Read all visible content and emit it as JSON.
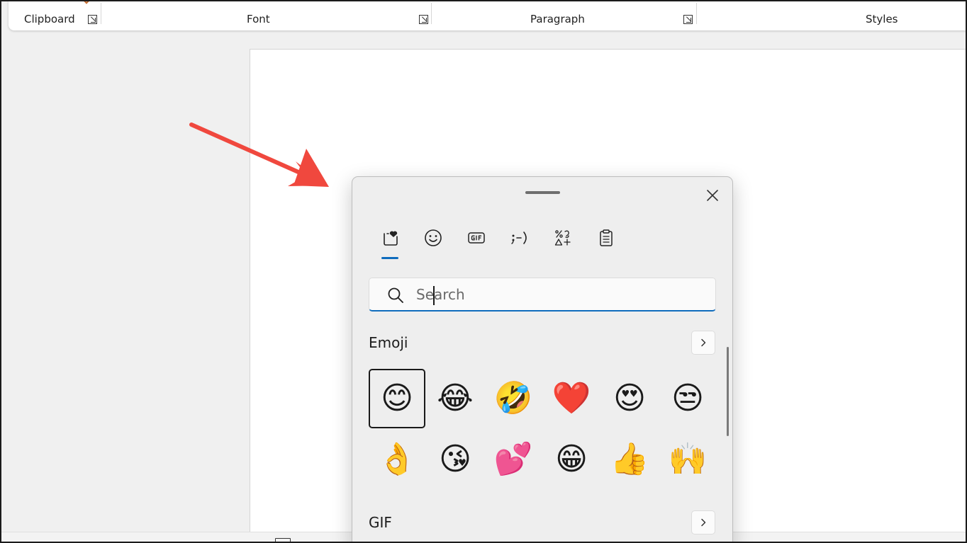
{
  "ribbon": {
    "groups": [
      {
        "label": "Clipboard"
      },
      {
        "label": "Font"
      },
      {
        "label": "Paragraph"
      },
      {
        "label": "Styles"
      }
    ]
  },
  "emoji_panel": {
    "tabs": [
      {
        "icon": "favorites-heart-icon"
      },
      {
        "icon": "smiley-icon"
      },
      {
        "icon": "gif-icon"
      },
      {
        "icon": "kaomoji-icon"
      },
      {
        "icon": "symbols-icon"
      },
      {
        "icon": "clipboard-history-icon"
      }
    ],
    "active_tab": 0,
    "search": {
      "placeholder": "Search",
      "value": ""
    },
    "sections": {
      "emoji": {
        "title": "Emoji"
      },
      "gif": {
        "title": "GIF"
      }
    },
    "emoji_grid": [
      [
        "😊",
        "😂",
        "🤣",
        "❤️",
        "😍",
        "😒"
      ],
      [
        "👌",
        "😘",
        "💕",
        "😁",
        "👍",
        "🙌"
      ]
    ],
    "selected_emoji": "😊"
  },
  "colors": {
    "accent": "#0f6cbd",
    "arrow": "#f0483e",
    "panel_bg": "#eeeeee"
  }
}
